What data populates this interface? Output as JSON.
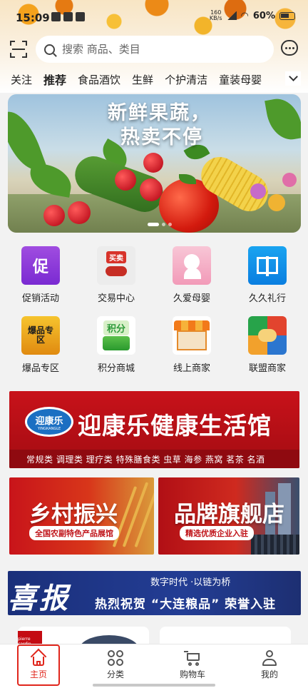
{
  "status_bar": {
    "time": "15:09",
    "net_speed_value": "160",
    "net_speed_unit": "KB/s",
    "battery": "60%"
  },
  "search": {
    "placeholder": "搜索 商品、类目"
  },
  "tabs": [
    "关注",
    "推荐",
    "食品酒饮",
    "生鲜",
    "个护清洁",
    "童装母婴"
  ],
  "active_tab": "推荐",
  "hero": {
    "title_line1": "新鲜果蔬，",
    "title_line2": "热卖不停"
  },
  "categories": [
    {
      "label": "促销活动",
      "icon": "promo-gift-icon",
      "glyph": "促"
    },
    {
      "label": "交易中心",
      "icon": "trade-handshake-icon",
      "glyph": "买卖"
    },
    {
      "label": "久爱母婴",
      "icon": "mother-baby-icon",
      "glyph": ""
    },
    {
      "label": "久久礼行",
      "icon": "gift-box-icon",
      "glyph": ""
    },
    {
      "label": "爆品专区",
      "icon": "hot-product-icon",
      "glyph": "爆品专区"
    },
    {
      "label": "积分商城",
      "icon": "points-mall-icon",
      "glyph": "积分"
    },
    {
      "label": "线上商家",
      "icon": "online-store-icon",
      "glyph": ""
    },
    {
      "label": "联盟商家",
      "icon": "alliance-handshake-icon",
      "glyph": ""
    }
  ],
  "health_banner": {
    "logo_text": "迎康乐",
    "logo_sub": "YINGKANGLE",
    "title": "迎康乐健康生活馆",
    "subtitle": "常规类  调理类  理疗类  特殊膳食类  虫草  海参  燕窝  茗茶  名酒"
  },
  "rural_banner": {
    "title": "乡村振兴",
    "subtitle": "全国农副特色产品展馆"
  },
  "brand_banner": {
    "title": "品牌旗舰店",
    "subtitle": "精选优质企业入驻"
  },
  "news_banner": {
    "big": "喜报",
    "top": "数字时代 ·以链为桥",
    "main": "热烈祝贺 “大连粮品” 荣誉入驻"
  },
  "product_card_logo": "pierre cardin",
  "bottom_nav": [
    {
      "label": "主页",
      "icon": "home-icon"
    },
    {
      "label": "分类",
      "icon": "category-icon"
    },
    {
      "label": "购物车",
      "icon": "cart-icon"
    },
    {
      "label": "我的",
      "icon": "profile-icon"
    }
  ],
  "colors": {
    "accent_red": "#e0261c",
    "health_red": "#c8121a",
    "news_blue": "#1a2f7a"
  }
}
